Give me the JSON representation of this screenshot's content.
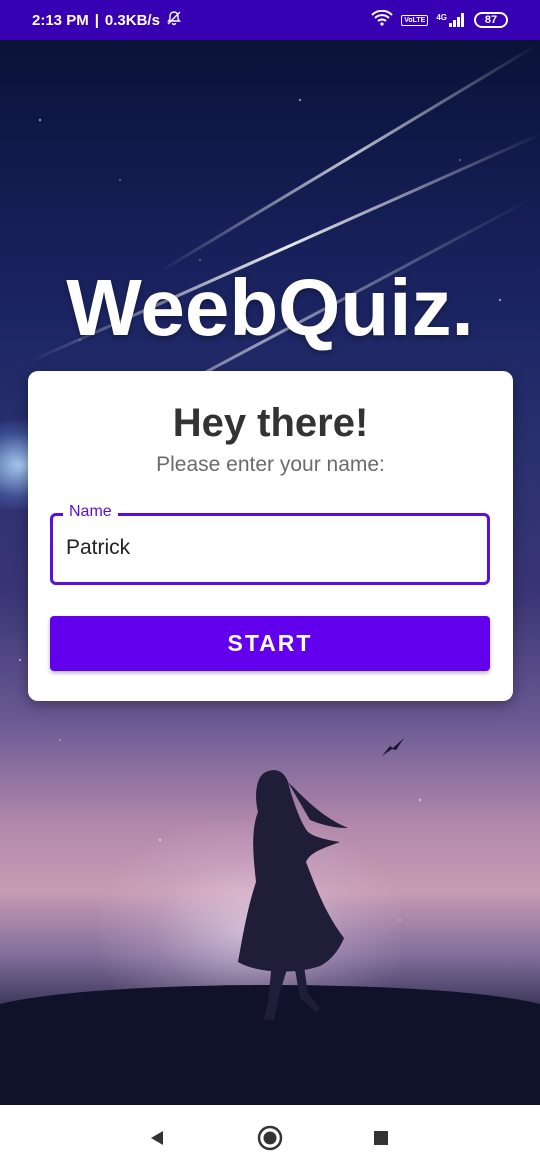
{
  "status_bar": {
    "time": "2:13 PM",
    "speed": "0.3KB/s",
    "volte": "VoLTE",
    "network": "4G",
    "battery": "87"
  },
  "app": {
    "title": "WeebQuiz."
  },
  "card": {
    "title": "Hey there!",
    "subtitle": "Please enter your name:",
    "name_field": {
      "label": "Name",
      "value": "Patrick"
    },
    "start_button": "START"
  },
  "colors": {
    "primary": "#6200ee",
    "status_bar": "#3700b3",
    "field_border": "#5a10d8"
  },
  "icons": {
    "back": "back-triangle-icon",
    "home": "home-circle-icon",
    "recents": "recents-square-icon"
  }
}
